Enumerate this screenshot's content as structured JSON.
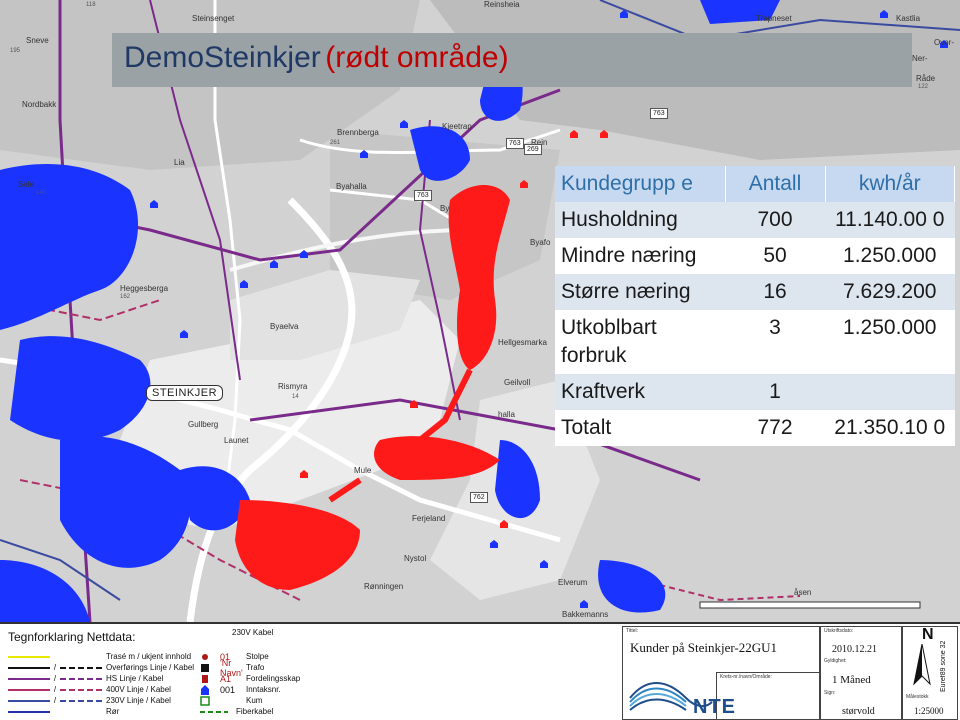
{
  "title": {
    "main": "DemoSteinkjer",
    "sub": "(rødt område)"
  },
  "table": {
    "headers": [
      "Kundegrupp e",
      "Antall",
      "kwh/år"
    ],
    "rows": [
      {
        "group": "Husholdning",
        "count": "700",
        "kwh": "11.140.00 0"
      },
      {
        "group": "Mindre næring",
        "count": "50",
        "kwh": "1.250.000"
      },
      {
        "group": "Større næring",
        "count": "16",
        "kwh": "7.629.200"
      },
      {
        "group": "Utkoblbart forbruk",
        "count": "3",
        "kwh": "1.250.000"
      },
      {
        "group": "Kraftverk",
        "count": "1",
        "kwh": ""
      },
      {
        "group": "Totalt",
        "count": "772",
        "kwh": "21.350.10 0"
      }
    ]
  },
  "map": {
    "city_label": "STEINKJER",
    "places": [
      "Sneve",
      "Steinsenget",
      "Reinsheia",
      "Trapneset",
      "Kastlia",
      "Over-",
      "Ner-",
      "Nordbakk",
      "Brennberga",
      "Rein",
      "Kjeetran",
      "Lia",
      "Sele",
      "Byahalla",
      "By",
      "Byafo",
      "Heggesberga",
      "Byaelva",
      "Hellgesmarka",
      "Rismyra",
      "Geilvoll",
      "halla",
      "Gullberg",
      "Launet",
      "Mule",
      "Ferjeland",
      "Nystol",
      "Rønningen",
      "Elverum",
      "Bakkemanns",
      "åsen",
      "Råde"
    ],
    "elevations": [
      "118",
      "195",
      "261",
      "140",
      "162",
      "14",
      "122"
    ],
    "road_numbers": [
      "763",
      "763",
      "763",
      "762",
      "269"
    ]
  },
  "legend": {
    "title": "Tegnforklaring Nettdata:",
    "cable_230": "230V Kabel",
    "lines": [
      {
        "label": "Trasé m / ukjent innhold",
        "color": "#e8e800"
      },
      {
        "label": "Overførings Linje / Kabel",
        "color": "#111111"
      },
      {
        "label": "HS Linje / Kabel",
        "color": "#7a2a8a"
      },
      {
        "label": "400V Linje / Kabel",
        "color": "#b0306a"
      },
      {
        "label": "230V Linje / Kabel",
        "color": "#3a4aa0"
      },
      {
        "label": "Rør",
        "color": "#2233aa"
      }
    ],
    "slash": "/",
    "symbols": [
      {
        "code": "01",
        "label": "Stolpe"
      },
      {
        "code": "'Nr Navn'",
        "label": "Trafo"
      },
      {
        "code": "A1",
        "label": "Fordelingsskap"
      },
      {
        "code": "001",
        "label": "Inntaksnr."
      },
      {
        "code": "",
        "label": "Kum"
      },
      {
        "code": "",
        "label": "Fiberkabel"
      }
    ],
    "info": {
      "title_label": "Tittel:",
      "title_value": "Kunder på Steinkjer-22GU1",
      "krets_label": "Krets-nr./navn/Område:",
      "date_label": "Utskriftsdato:",
      "date_value": "2010.12.21",
      "validity_label": "Gyldighet:",
      "validity_value": "1 Måned",
      "sign_label": "Sign:",
      "sign_value": "størvold",
      "scale_label": "Målestokk",
      "scale_value": "1:25000",
      "north": "N",
      "projection": "Euref89 sone 32",
      "logo": "NTE"
    }
  },
  "colors": {
    "red_area": "#ff1a1a",
    "blue_points": "#1a33ff",
    "banner": "#9aa2a6",
    "table_header": "#c6d9f1"
  }
}
